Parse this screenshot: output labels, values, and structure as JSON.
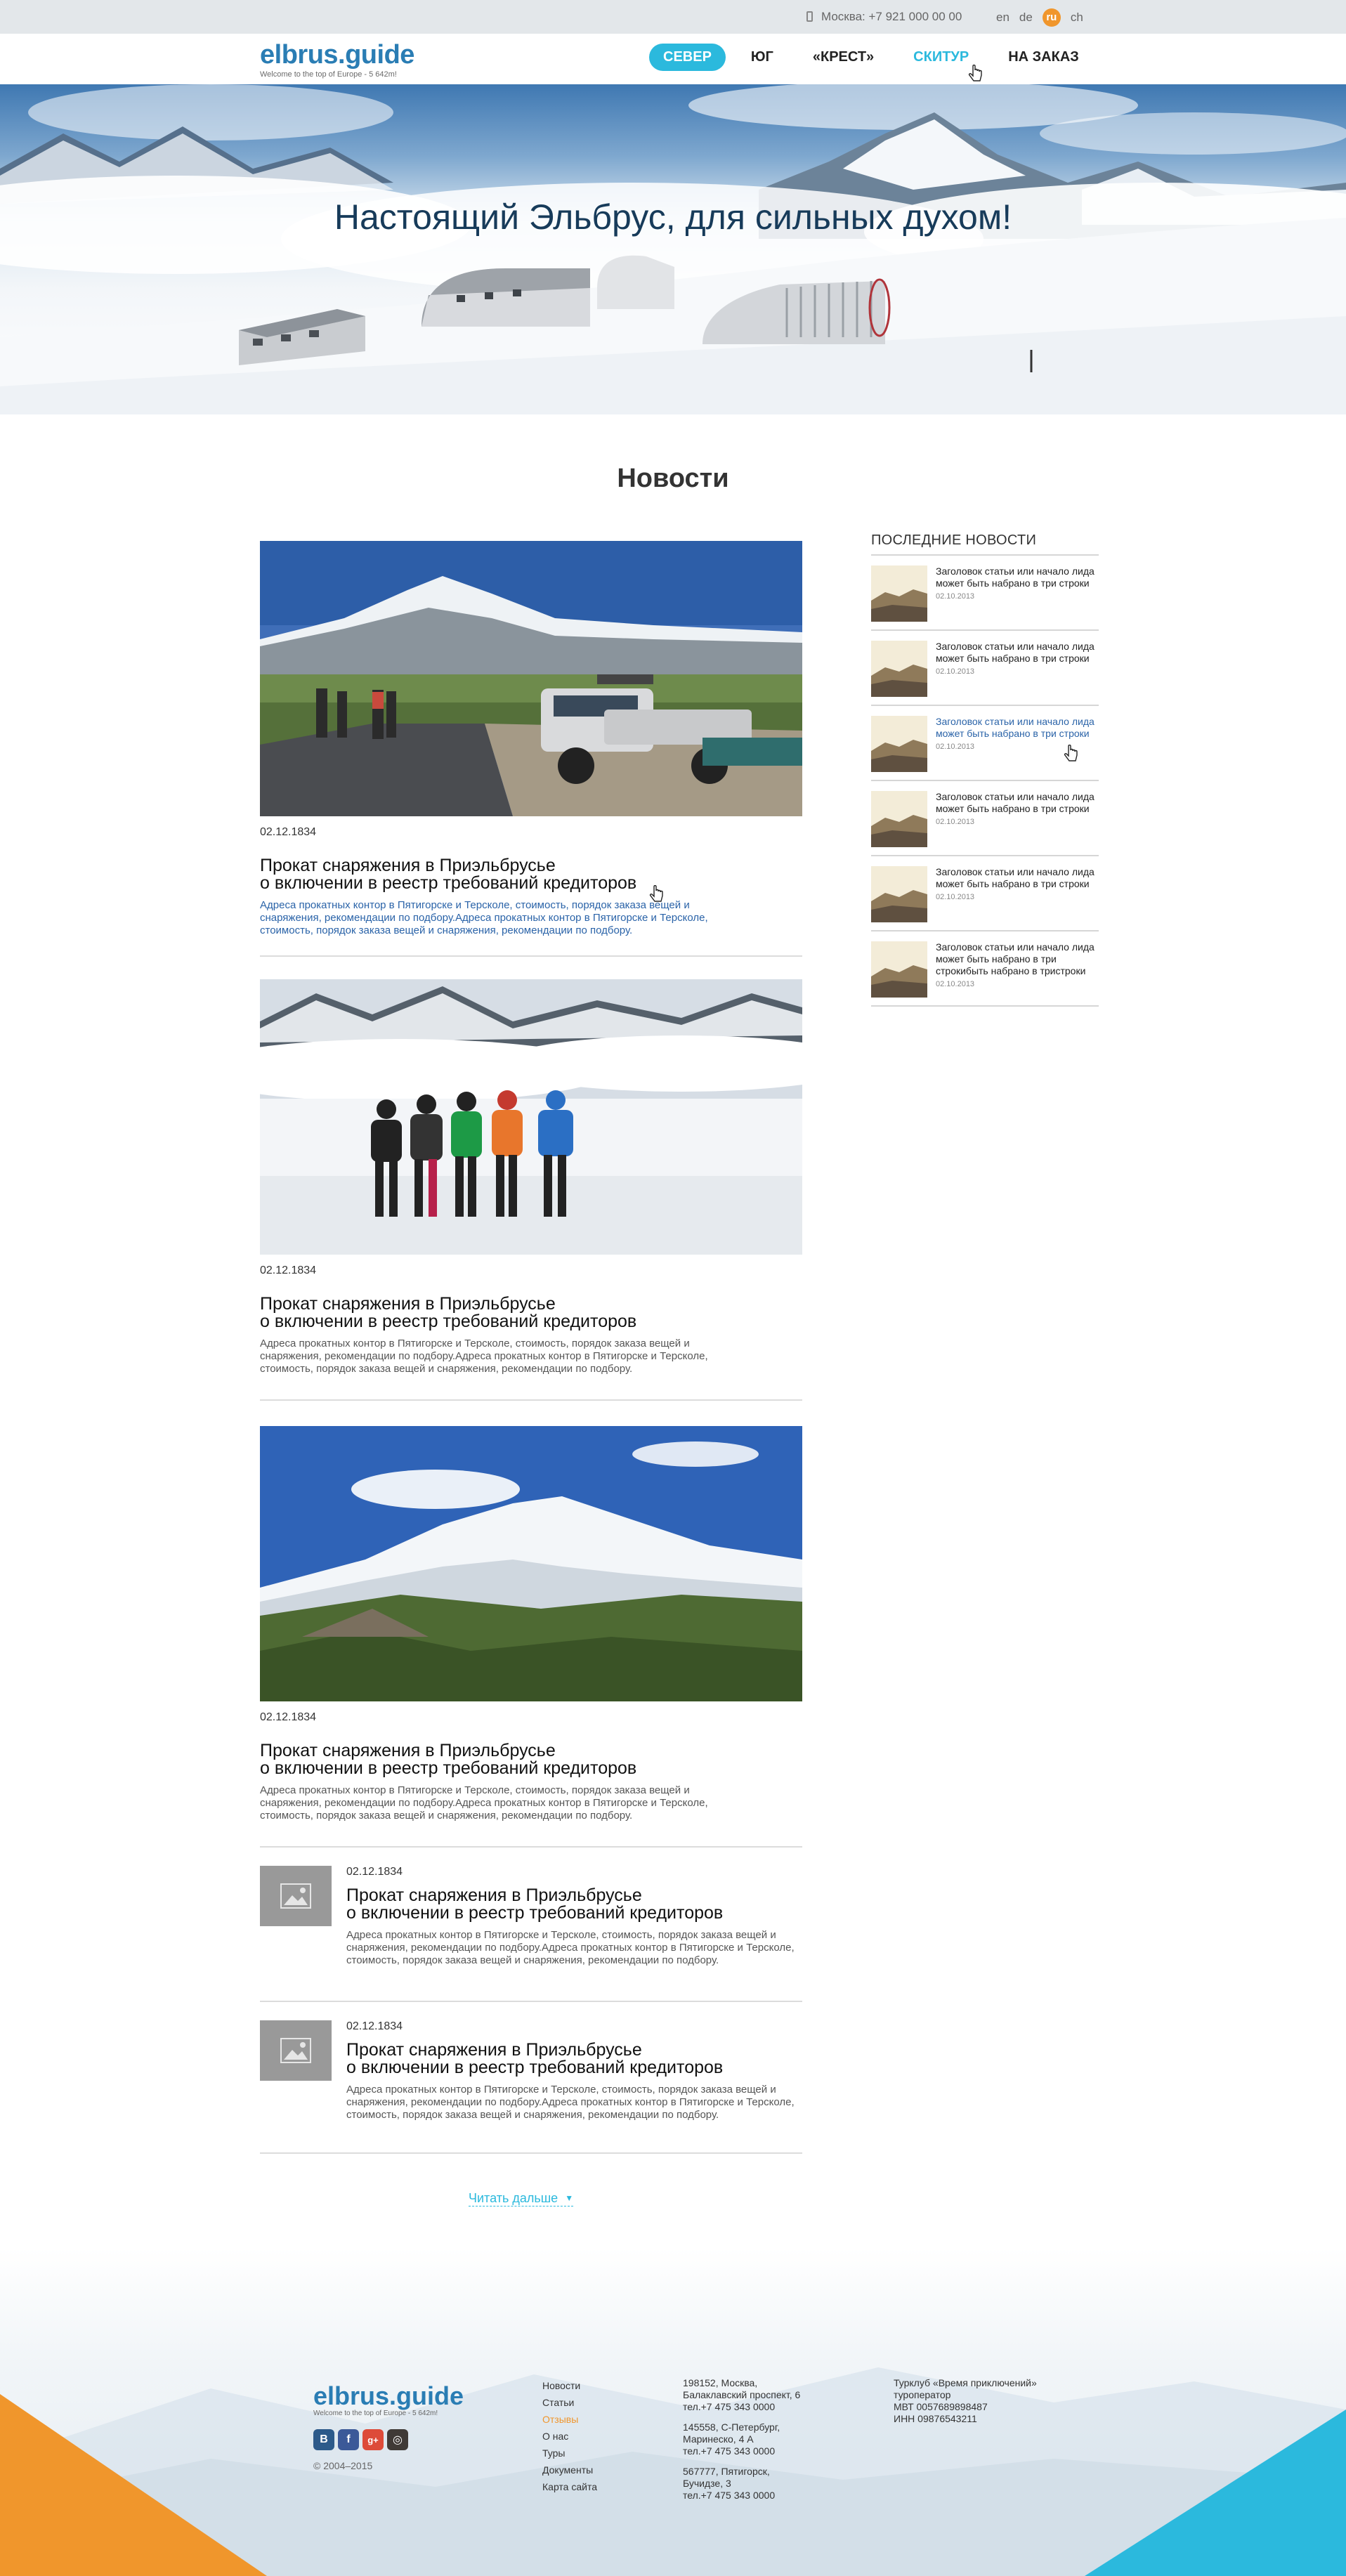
{
  "topbar": {
    "phone": "Москва: +7 921 000 00 00",
    "languages": [
      "en",
      "de",
      "ru",
      "ch"
    ],
    "active_language": "ru"
  },
  "header": {
    "logo": "elbrus.guide",
    "tagline": "Welcome to the top of Europe - 5 642m!",
    "nav": [
      {
        "label": "Север",
        "state": "active-pill"
      },
      {
        "label": "Юг",
        "state": "normal"
      },
      {
        "label": "«Крест»",
        "state": "normal"
      },
      {
        "label": "Скитур",
        "state": "hover"
      },
      {
        "label": "На заказ",
        "state": "normal"
      }
    ]
  },
  "hero": {
    "title": "Настоящий Эльбрус, для сильных духом!"
  },
  "main": {
    "section_title": "Новости",
    "posts": [
      {
        "date": "02.12.1834",
        "title_line1": "Прокат снаряжения в Приэльбрусье",
        "title_line2": "о включении в реестр требований кредиторов",
        "excerpt": "Адреса прокатных контор в Пятигорске и Терсколе, стоимость, порядок заказа вещей и снаряжения, рекомендации по подбору.Адреса прокатных контор в Пятигорске и Терсколе, стоимость, порядок заказа вещей и снаряжения, рекомендации по подбору.",
        "image": "mountain-road-car-photo"
      },
      {
        "date": "02.12.1834",
        "title_line1": "Прокат снаряжения в Приэльбрусье",
        "title_line2": "о включении в реестр требований кредиторов",
        "excerpt": "Адреса прокатных контор в Пятигорске и Терсколе, стоимость, порядок заказа вещей и снаряжения, рекомендации по подбору.Адреса прокатных контор в Пятигорске и Терсколе, стоимость, порядок заказа вещей и снаряжения, рекомендации по подбору.",
        "image": "climbers-on-snow-photo"
      },
      {
        "date": "02.12.1834",
        "title_line1": "Прокат снаряжения в Приэльбрусье",
        "title_line2": "о включении в реестр требований кредиторов",
        "excerpt": "Адреса прокатных контор в Пятигорске и Терсколе, стоимость, порядок заказа вещей и снаряжения, рекомендации по подбору.Адреса прокатных контор в Пятигорске и Терсколе, стоимость, порядок заказа вещей и снаряжения, рекомендации по подбору.",
        "image": "elbrus-peak-photo"
      },
      {
        "date": "02.12.1834",
        "title_line1": "Прокат снаряжения в Приэльбрусье",
        "title_line2": "о включении в реестр требований кредиторов",
        "excerpt": "Адреса прокатных контор в Пятигорске и Терсколе, стоимость, порядок заказа вещей и снаряжения, рекомендации по подбору.Адреса прокатных контор в Пятигорске и Терсколе, стоимость, порядок заказа вещей и снаряжения, рекомендации по подбору.",
        "image": "image-placeholder-icon"
      },
      {
        "date": "02.12.1834",
        "title_line1": "Прокат снаряжения в Приэльбрусье",
        "title_line2": "о включении в реестр требований кредиторов",
        "excerpt": "Адреса прокатных контор в Пятигорске и Терсколе, стоимость, порядок заказа вещей и снаряжения, рекомендации по подбору.Адреса прокатных контор в Пятигорске и Терсколе, стоимость, порядок заказа вещей и снаряжения, рекомендации по подбору.",
        "image": "image-placeholder-icon"
      }
    ],
    "read_more": "Читать дальше"
  },
  "sidebar": {
    "heading": "Последние новости",
    "items": [
      {
        "title": "Заголовок статьи или  начало лида может быть набрано в три строки",
        "date": "02.10.2013"
      },
      {
        "title": "Заголовок статьи или  начало лида может быть набрано в три строки",
        "date": "02.10.2013"
      },
      {
        "title": "Заголовок статьи или  начало лида может быть набрано в три строки",
        "date": "02.10.2013"
      },
      {
        "title": "Заголовок статьи или  начало лида может быть набрано в три строки",
        "date": "02.10.2013"
      },
      {
        "title": "Заголовок статьи или  начало лида может быть набрано в три строки",
        "date": "02.10.2013"
      },
      {
        "title": "Заголовок статьи или  начало лида может быть набрано в три строкибыть набрано в тристроки",
        "date": "02.10.2013"
      }
    ]
  },
  "footer": {
    "logo": "elbrus.guide",
    "tagline": "Welcome to the top of Europe - 5 642m!",
    "socials": [
      "В",
      "f",
      "g+",
      "◎"
    ],
    "copyright": "© 2004–2015",
    "menu": [
      "Новости",
      "Статьи",
      "Отзывы",
      "О нас",
      "Туры",
      "Документы",
      "Карта сайта"
    ],
    "active_menu": "Отзывы",
    "addresses": [
      [
        "198152, Москва,",
        "Балаклавский проспект, 6",
        "тел.+7 475 343 0000"
      ],
      [
        "145558, С-Петербург,",
        "Маринеско, 4 А",
        "тел.+7 475 343 0000"
      ],
      [
        "567777, Пятигорск,",
        "Бучидзе, 3",
        "тел.+7 475 343 0000"
      ]
    ],
    "company": [
      "Турклуб «Время приключений»",
      "туроператор",
      "МВТ 0057689898487",
      "ИНН 09876543211"
    ]
  },
  "colors": {
    "accent": "#2bb9dd",
    "brand": "#2a7db4",
    "orange": "#f0962c",
    "link": "#2a63a8"
  }
}
